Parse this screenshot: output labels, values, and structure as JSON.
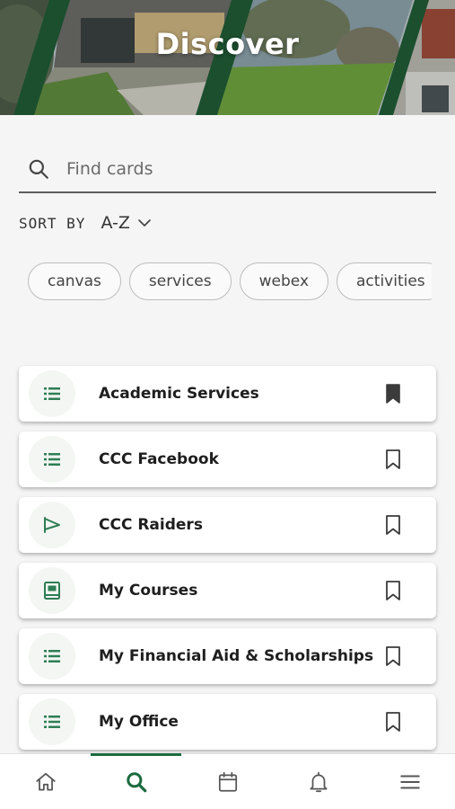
{
  "header": {
    "title": "Discover"
  },
  "search": {
    "placeholder": "Find cards",
    "value": ""
  },
  "sort": {
    "label": "SORT BY",
    "value": "A-Z"
  },
  "chips": [
    "canvas",
    "services",
    "webex",
    "activities"
  ],
  "cards": [
    {
      "label": "Academic Services",
      "icon": "list-icon",
      "bookmarked": true
    },
    {
      "label": "CCC Facebook",
      "icon": "list-icon",
      "bookmarked": false
    },
    {
      "label": "CCC Raiders",
      "icon": "pennant-flag-icon",
      "bookmarked": false
    },
    {
      "label": "My Courses",
      "icon": "book-icon",
      "bookmarked": false
    },
    {
      "label": "My Financial Aid & Scholarships",
      "icon": "list-icon",
      "bookmarked": false
    },
    {
      "label": "My Office",
      "icon": "list-icon",
      "bookmarked": false
    }
  ],
  "nav": [
    {
      "name": "home",
      "icon": "home-icon",
      "active": false
    },
    {
      "name": "discover",
      "icon": "search-icon",
      "active": true
    },
    {
      "name": "calendar",
      "icon": "calendar-icon",
      "active": false
    },
    {
      "name": "notifications",
      "icon": "bell-icon",
      "active": false
    },
    {
      "name": "menu",
      "icon": "hamburger-menu-icon",
      "active": false
    }
  ],
  "colors": {
    "accent": "#1b6b3f",
    "icon_green": "#2e7d55",
    "banner_stripe": "#1f5a35",
    "background": "#f5f5f5"
  }
}
